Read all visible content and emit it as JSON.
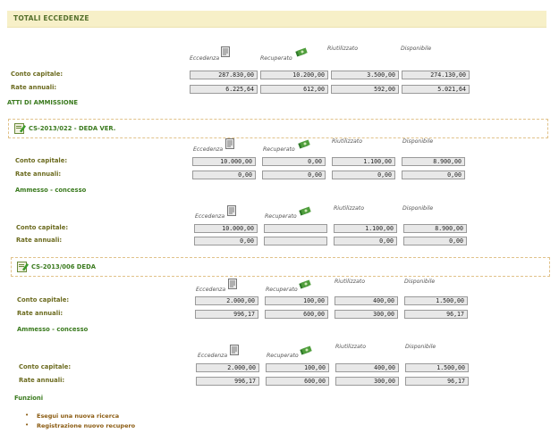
{
  "header": {
    "title": "TOTALI ECCEDENZE"
  },
  "columns": {
    "eccedenza": "Eccedenza",
    "recuperato": "Recuperato",
    "riutilizzato": "Riutilizzato",
    "disponibile": "Disponibile"
  },
  "rows": {
    "conto": "Conto capitale:",
    "rate": "Rate annuali:"
  },
  "totals": {
    "conto": [
      "287.830,00",
      "10.200,00",
      "3.500,00",
      "274.130,00"
    ],
    "rate": [
      "6.225,64",
      "612,00",
      "592,00",
      "5.021,64"
    ]
  },
  "atti_title": "ATTI DI AMMISSIONE",
  "sections": [
    {
      "title": "CS-2013/022 - DEDA VER.",
      "conto": [
        "10.000,00",
        "0,00",
        "1.100,00",
        "8.900,00"
      ],
      "rate": [
        "0,00",
        "0,00",
        "0,00",
        "0,00"
      ],
      "ammesso_label": "Ammesso - concesso",
      "ammesso_conto": [
        "10.000,00",
        "",
        "1.100,00",
        "8.900,00"
      ],
      "ammesso_rate": [
        "0,00",
        "",
        "0,00",
        "0,00"
      ]
    },
    {
      "title": "CS-2013/006 DEDA",
      "conto": [
        "2.000,00",
        "100,00",
        "400,00",
        "1.500,00"
      ],
      "rate": [
        "996,17",
        "600,00",
        "300,00",
        "96,17"
      ],
      "ammesso_label": "Ammesso - concesso",
      "ammesso_conto": [
        "2.000,00",
        "100,00",
        "400,00",
        "1.500,00"
      ],
      "ammesso_rate": [
        "996,17",
        "600,00",
        "300,00",
        "96,17"
      ]
    }
  ],
  "funzioni": {
    "title": "Funzioni",
    "links": [
      "Esegui una nuova ricerca",
      "Registrazione nuovo recupero"
    ]
  },
  "icons": {
    "eccedenza": "document-icon",
    "recuperato": "money-icon",
    "section": "edit-document-icon"
  }
}
